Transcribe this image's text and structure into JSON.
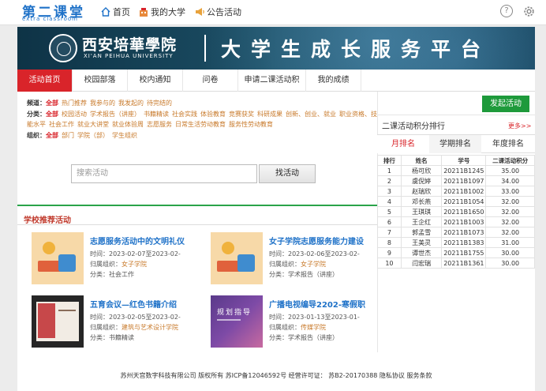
{
  "app": {
    "logo_cn": "第二课堂",
    "logo_en": "extra classroom"
  },
  "topnav": {
    "home": "首页",
    "my_university": "我的大学",
    "announcements": "公告活动"
  },
  "banner": {
    "school_cn": "西安培華學院",
    "school_en": "XI'AN PEIHUA UNIVERSITY",
    "platform": "大学生成长服务平台"
  },
  "nav": [
    "活动首页",
    "校园部落",
    "校内通知",
    "问卷",
    "申请二课活动积",
    "我的成绩"
  ],
  "filters": {
    "channel_label": "频道：",
    "channel_all": "全部",
    "channel_opts": [
      "热门推荐",
      "我参与的",
      "我发起的",
      "待完结的"
    ],
    "category_label": "分类：",
    "category_all": "全部",
    "category_opts": [
      "校园活动",
      "学术报告（讲座）",
      "书籍精读",
      "社会实践",
      "体验教育",
      "竞赛获奖",
      "科研成果",
      "创新、创业、就业",
      "职业资格、技能水平",
      "社会工作",
      "就业大讲堂",
      "就业体验周",
      "志愿服务",
      "日常生活劳动教育",
      "服务性劳动教育"
    ],
    "org_label": "组织：",
    "org_all": "全部",
    "org_opts": [
      "部门",
      "学院（部）",
      "学生组织"
    ]
  },
  "search": {
    "placeholder": "搜索活动",
    "button": "找活动"
  },
  "recommend": {
    "title": "学校推荐活动",
    "cards": [
      {
        "title": "志愿服务活动中的文明礼仪",
        "time": "时间：2023-02-07至2023-02-",
        "org_prefix": "归属组织：",
        "org": "女子学院",
        "cat": "分类：社会工作"
      },
      {
        "title": "女子学院志愿服务能力建设",
        "time": "时间：2023-02-06至2023-02-",
        "org_prefix": "归属组织：",
        "org": "女子学院",
        "cat": "分类：学术报告（讲座）"
      },
      {
        "title": "五育会议—红色书籍介绍",
        "time": "时间：2023-02-05至2023-02-",
        "org_prefix": "归属组织：",
        "org": "建筑与艺术设计学院",
        "cat": "分类：书籍精读"
      },
      {
        "title": "广播电视编导2202-寒假职",
        "time": "时间：2023-01-13至2023-01-",
        "org_prefix": "归属组织：",
        "org": "传媒学院",
        "cat": "分类：学术报告（讲座）"
      }
    ],
    "thumb_text": "规划指导"
  },
  "sidebar": {
    "launch": "发起活动",
    "rank_title": "二课活动积分排行",
    "more": "更多>>",
    "tabs": [
      "月排名",
      "学期排名",
      "年度排名"
    ],
    "headers": [
      "排行",
      "姓名",
      "学号",
      "二课活动积分"
    ],
    "rows": [
      [
        "1",
        "杨可欣",
        "20211B1245",
        "35.00"
      ],
      [
        "2",
        "虞倪婷",
        "20211B1097",
        "34.00"
      ],
      [
        "3",
        "赵瑞欣",
        "20211B1002",
        "33.00"
      ],
      [
        "4",
        "邓长燕",
        "20211B1054",
        "32.00"
      ],
      [
        "5",
        "王琪琪",
        "20211B1650",
        "32.00"
      ],
      [
        "6",
        "王企红",
        "20211B1003",
        "32.00"
      ],
      [
        "7",
        "郭孟雪",
        "20211B1073",
        "32.00"
      ],
      [
        "8",
        "王美灵",
        "20211B1383",
        "31.00"
      ],
      [
        "9",
        "谭世杰",
        "20211B1755",
        "30.00"
      ],
      [
        "10",
        "闫宏瑞",
        "20211B1361",
        "30.00"
      ]
    ]
  },
  "footer": "苏州天宫数字科技有限公司 版权所有 苏ICP备12046592号 经营许可证： 苏B2-20170388 隐私协议 服务条款",
  "colors": {
    "accent_red": "#d9242a",
    "link_blue": "#1f72c8",
    "green": "#1e9a3b",
    "orange": "#c87a2b"
  }
}
